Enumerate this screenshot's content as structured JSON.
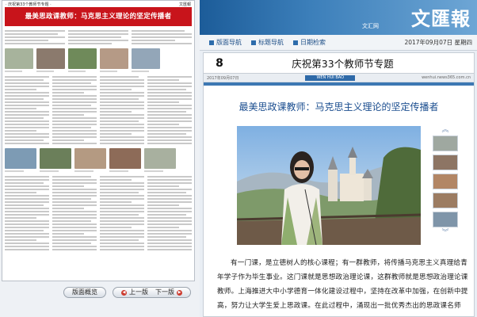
{
  "left_thumbnail": {
    "top_label": "· 庆祝第33个教师节专题 ·",
    "brand_small": "文匯報",
    "banner": "最美思政课教师：马克思主义理论的坚定传播者"
  },
  "buttons": {
    "overview": "版面概览",
    "prev": "上一版",
    "next": "下一版"
  },
  "header": {
    "tag": "文汇网",
    "logo": "文匯報"
  },
  "nav": {
    "items": [
      "版面导航",
      "标题导航",
      "日期检索"
    ],
    "date": "2017年09月07日 星期四"
  },
  "page": {
    "number": "8",
    "title": "庆祝第33个教师节专题"
  },
  "ribbon": {
    "left": "2017年09月07日",
    "mid": "WEN HUI BAO",
    "right": "wenhui.news365.com.cn"
  },
  "article": {
    "title": "最美思政课教师：马克思主义理论的坚定传播者",
    "body": "有一门课，是立德树人的核心课程；有一群教师，将传播马克思主义真理给青年学子作为毕生事业。这门课就是思想政治理论课，这群教师就是思想政治理论课教师。上海推进大中小学德育一体化建设过程中，坚持在改革中加强，在创新中提高，努力让大学生爱上思政课。在此过程中，涌现出一批优秀杰出的思政课名师"
  },
  "colors": {
    "banner_red": "#c8141b",
    "header_blue": "#1c5c99",
    "title_blue": "#1a4d8f"
  },
  "icons": [
    "up-arrow-icon",
    "down-arrow-icon",
    "nav-square-icon"
  ]
}
